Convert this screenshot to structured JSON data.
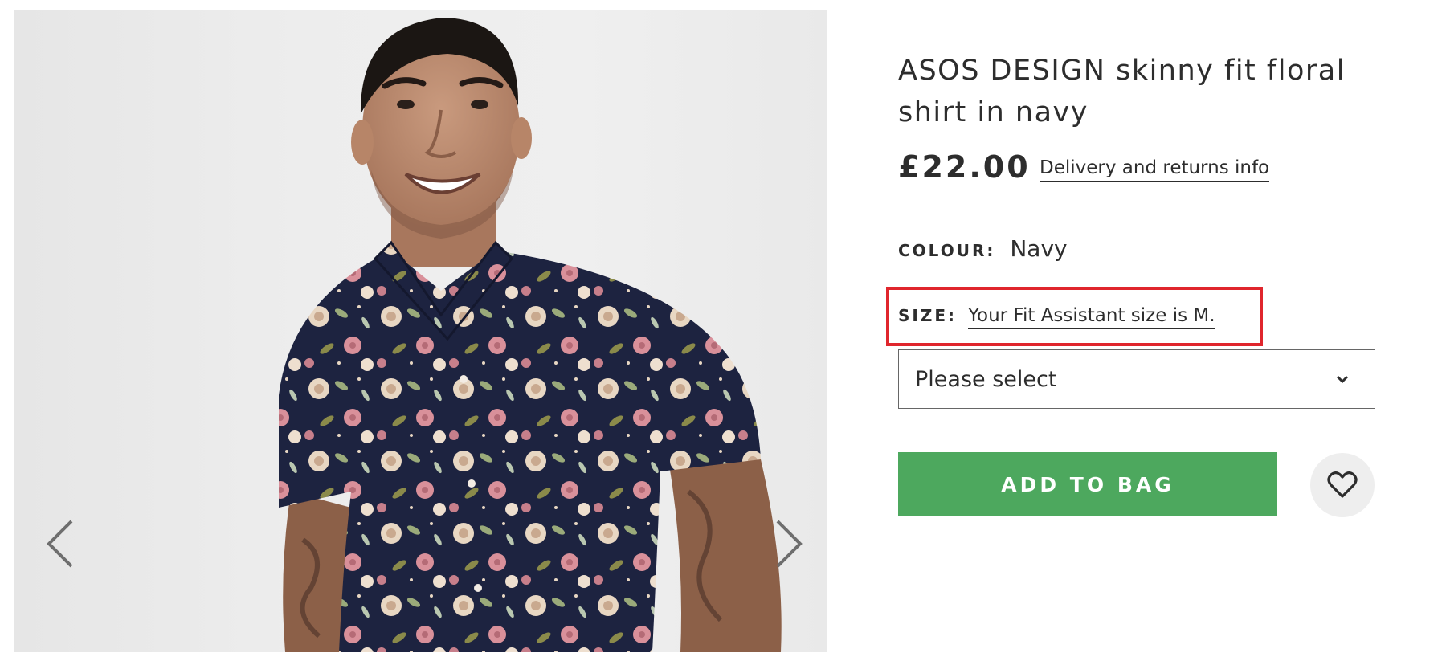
{
  "gallery": {
    "image_alt": "",
    "prev_icon": "chevron-left-icon",
    "next_icon": "chevron-right-icon"
  },
  "product": {
    "title": "ASOS DESIGN skinny fit floral shirt in navy",
    "price": "£22.00",
    "delivery_link": "Delivery and returns info",
    "colour_label": "COLOUR:",
    "colour_value": "Navy",
    "size_label": "SIZE:",
    "size_assistant": "Your Fit Assistant size is M.",
    "size_select_value": "Please select",
    "size_select_icon": "chevron-down-icon",
    "add_to_bag_label": "ADD TO BAG",
    "save_icon": "heart-icon"
  },
  "colors": {
    "add_to_bag_bg": "#4da85e",
    "highlight_border": "#e0262d",
    "text": "#2d2d2d"
  }
}
